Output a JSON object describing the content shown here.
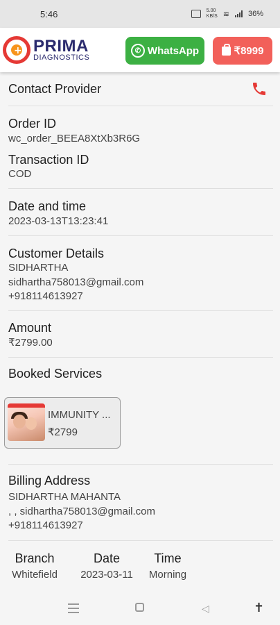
{
  "status_bar": {
    "time": "5:46",
    "net_speed_top": "5.00",
    "net_speed_bottom": "KB/S",
    "battery": "36%"
  },
  "header": {
    "logo_brand": "PRIMA",
    "logo_sub": "DIAGNOSTICS",
    "whatsapp_label": "WhatsApp",
    "cart_label": "₹8999",
    "colors": {
      "whatsapp": "#3cb043",
      "cart": "#f2605a",
      "brand": "#2b2b6e",
      "accent": "#e53935"
    }
  },
  "order": {
    "contact_label": "Contact Provider",
    "order_id_label": "Order ID",
    "order_id": "wc_order_BEEA8XtXb3R6G",
    "transaction_label": "Transaction ID",
    "transaction_id": "COD",
    "datetime_label": "Date and time",
    "datetime": "2023-03-13T13:23:41",
    "customer_label": "Customer Details",
    "customer_name": "SIDHARTHA",
    "customer_email": "sidhartha758013@gmail.com",
    "customer_phone": "+918114613927",
    "amount_label": "Amount",
    "amount": "₹2799.00",
    "booked_label": "Booked Services",
    "service": {
      "name": "IMMUNITY ...",
      "price": "₹2799"
    },
    "billing_label": "Billing Address",
    "billing_name": "SIDHARTHA MAHANTA",
    "billing_email": ", , sidhartha758013@gmail.com",
    "billing_phone": "+918114613927",
    "branch_label": "Branch",
    "branch": "Whitefield",
    "date_label": "Date",
    "date": "2023-03-11",
    "time_label": "Time",
    "time": "Morning"
  },
  "icons": {
    "phone": "phone-icon",
    "whatsapp": "whatsapp-icon",
    "cart": "shopping-bag-icon",
    "nav_menu": "menu-icon",
    "nav_home": "home-icon",
    "nav_back": "back-icon",
    "accessibility": "accessibility-icon"
  }
}
